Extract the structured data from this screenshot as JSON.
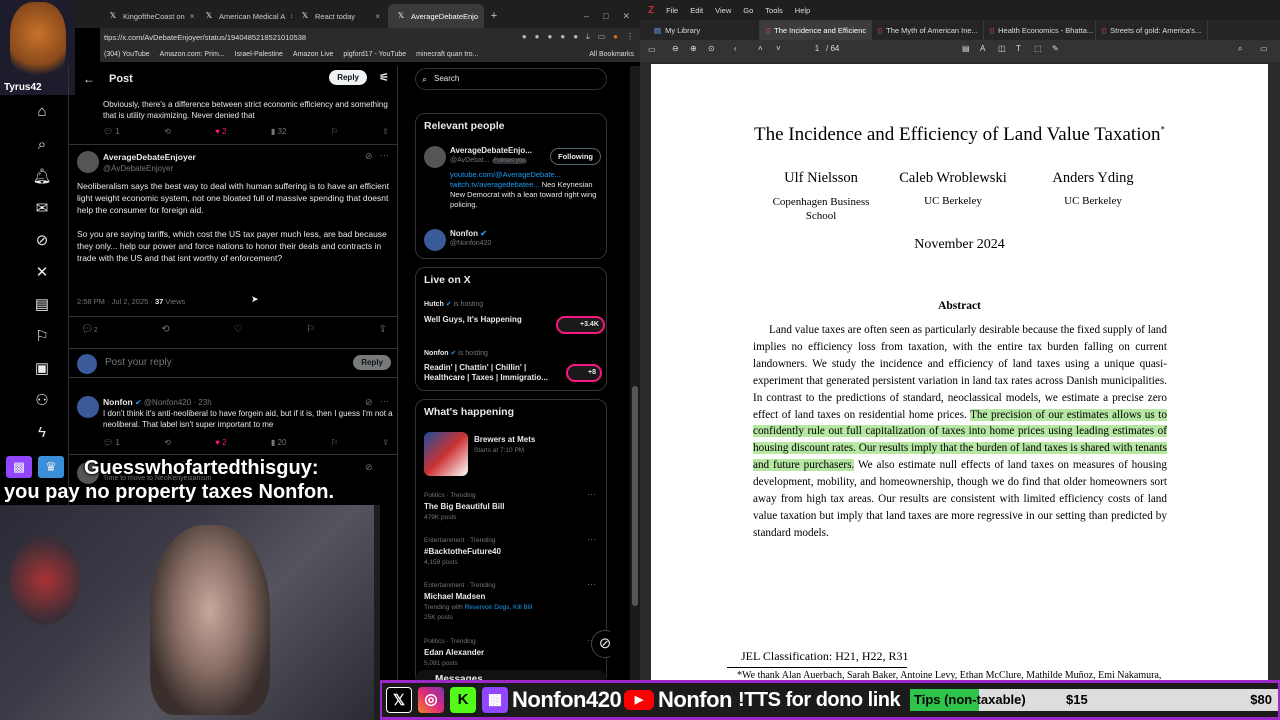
{
  "browser": {
    "tabs": [
      {
        "label": "KingoftheCoast on",
        "close": "×"
      },
      {
        "label": "American Medical A",
        "close": "×"
      },
      {
        "label": "React today",
        "close": "×"
      },
      {
        "label": "AverageDebateEnjo",
        "close": "×"
      }
    ],
    "new_tab": "+",
    "address": "ttps://x.com/AvDebateEnjoyer/status/1940485218521010538",
    "bookmarks": [
      "(304) YouTube",
      "Amazon.com: Prim...",
      "Israel-Palestine",
      "Amazon Live",
      "pigford17 - YouTube",
      "minecraft quan tro..."
    ],
    "all_bookmarks": "All Bookmarks"
  },
  "streamer_label": "Tyrus42",
  "feed": {
    "header_title": "Post",
    "reply_label": "Reply",
    "prev_reply": {
      "text": "Obviously, there's a difference between strict economic efficiency and something that is utility maximizing. Never denied that",
      "replies": "1",
      "likes": "2",
      "views": "32"
    },
    "main_post": {
      "name": "AverageDebateEnjoyer",
      "handle": "@AvDebateEnjoyer",
      "para1": "Neoliberalism says the best way to deal with human suffering is to have an efficient light weight economic system, not one bloated full of massive spending that doesnt help the consumer for foreign aid.",
      "para2": "So you are saying tariffs, which cost the US tax payer much less, are bad because they only... help our power and force nations to honor their deals and contracts in trade with the US and that isnt worthy of enforcement?",
      "meta_time": "2:58 PM · Jul 2, 2025 · ",
      "meta_views": "37",
      "meta_views_label": " Views",
      "replies": "2"
    },
    "reply_placeholder": "Post your reply",
    "reply_button": "Reply",
    "nonfon_reply": {
      "name": "Nonfon",
      "handle": "@Nonfon420 · 23h",
      "text": "I don't think it's anti-neoliberal to have forgein aid, but if it is, then I guess I'm not a neoliberal. That label isn't super important to me",
      "replies": "1",
      "likes": "2",
      "views": "20"
    },
    "partial_reply": "Time to move to NeoKenyesianism"
  },
  "sidebar": {
    "search_placeholder": "Search",
    "relevant_title": "Relevant people",
    "person1": {
      "name": "AverageDebateEnjo...",
      "handle": "@AvDebat...",
      "follows_you": "Follows you",
      "follow_label": "Following",
      "bio_link1": "youtube.com/@AverageDebate...",
      "bio_link2": "twitch.tv/averagedebatee...",
      "bio_text": " Neo Keynesian New Democrat with a lean toward right wing policing."
    },
    "person2": {
      "name": "Nonfon",
      "handle": "@Nonfon420"
    },
    "live_title": "Live on X",
    "live": [
      {
        "host": "Hutch",
        "hosting": "is hosting",
        "title": "Well Guys, It's Happening",
        "count": "+3.4K"
      },
      {
        "host": "Nonfon",
        "hosting": "is hosting",
        "title": "Readin' | Chattin' | Chillin' | Healthcare | Taxes | Immigratio...",
        "count": "+8"
      }
    ],
    "happening_title": "What's happening",
    "event": {
      "name": "Brewers at Mets",
      "time": "Starts at 7:10 PM"
    },
    "trends": [
      {
        "category": "Politics · Trending",
        "name": "The Big Beautiful Bill",
        "posts": "479K posts"
      },
      {
        "category": "Entertainment · Trending",
        "name": "#BacktotheFuture40",
        "posts": "4,159 posts"
      },
      {
        "category": "Entertainment · Trending",
        "name": "Michael Madsen",
        "posts_prefix": "Trending with ",
        "posts": "Reservoir Dogs, Kill Bill",
        "extra": "25K posts"
      },
      {
        "category": "Politics · Trending",
        "name": "Edan Alexander",
        "posts": "5,091 posts"
      }
    ],
    "messages": "Messages"
  },
  "caption": {
    "line1": "Guesswhofartedthisguy:",
    "line2": "you pay no property taxes Nonfon."
  },
  "zotero": {
    "menu": [
      "File",
      "Edit",
      "View",
      "Go",
      "Tools",
      "Help"
    ],
    "library_tab": "My Library",
    "tabs": [
      "The Incidence and Efficienc",
      "The Myth of American Ine...",
      "Health Economics - Bhatta...",
      "Streets of gold: America's..."
    ],
    "page_current": "1",
    "page_total": "/ 64"
  },
  "paper": {
    "title": "The Incidence and Efficiency of Land Value Taxation",
    "title_mark": "*",
    "authors": [
      {
        "name": "Ulf Nielsson",
        "affil": "Copenhagen Business School"
      },
      {
        "name": "Caleb Wroblewski",
        "affil": "UC Berkeley"
      },
      {
        "name": "Anders Yding",
        "affil": "UC Berkeley"
      }
    ],
    "date": "November 2024",
    "abstract_heading": "Abstract",
    "abstract_a": "Land value taxes are often seen as particularly desirable because the fixed supply of land implies no efficiency loss from taxation, with the entire tax burden falling on current landowners. We study the incidence and efficiency of land taxes using a unique quasi-experiment that generated persistent variation in land tax rates across Danish municipalities. In contrast to the predictions of standard, neoclassical models, we estimate a precise zero effect of land taxes on residential home prices. ",
    "abstract_highlight": "The precision of our estimates allows us to confidently rule out full capitalization of taxes into home prices using leading estimates of housing discount rates. Our results imply that the burden of land taxes is shared with tenants and future purchasers.",
    "abstract_b": " We also estimate null effects of land taxes on measures of housing development, mobility, and homeownership, though we do find that older homeowners sort away from high tax areas. Our results are consistent with limited efficiency costs of land value taxation but imply that land taxes are more regressive in our setting than predicted by standard models.",
    "jel": "JEL Classification: H21, H22, R31",
    "footnote": "*We thank Alan Auerbach, Sarah Baker, Antoine Levy, Ethan McClure, Mathilde Muñoz, Emi Nakamura,"
  },
  "stream_bar": {
    "name1": "Nonfon420",
    "name2": "Nonfon",
    "tts": "!TTS for dono link",
    "tips_label": "Tips (non-taxable)",
    "tips_current": "$15",
    "tips_goal": "$80",
    "progress": 0.1875
  },
  "colors": {
    "accent": "#1d9bf0",
    "like": "#f91880",
    "highlight": "#b6e7a3",
    "stream_purple": "#9c28c8",
    "tips_green": "#2ec44c"
  }
}
